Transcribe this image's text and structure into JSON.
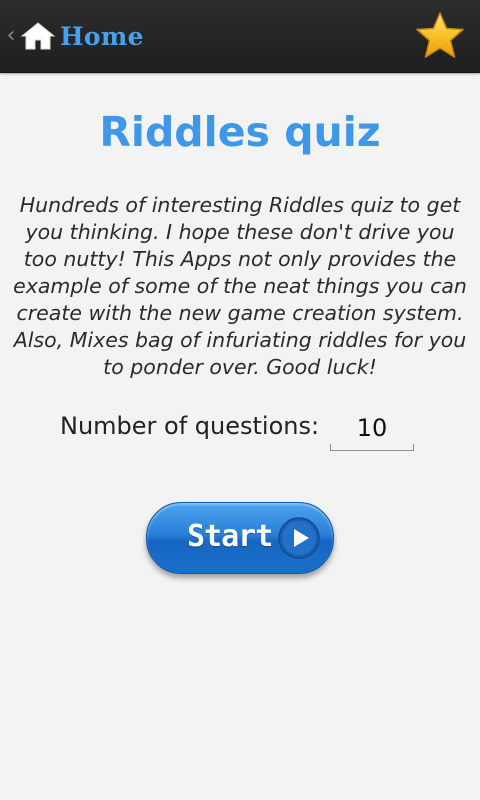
{
  "actionbar": {
    "home_label": "Home",
    "up_caret": "‹",
    "favorite_icon": "star-icon",
    "home_icon": "house-icon"
  },
  "content": {
    "title": "Riddles quiz",
    "description": "Hundreds of interesting Riddles quiz to get you thinking. I hope these don't drive you too nutty! This Apps not only provides the example of some of the neat things you can create with the new game creation system. Also, Mixes bag of infuriating  riddles for you to ponder over. Good luck!",
    "questions_label": "Number of questions:",
    "questions_value": "10",
    "start_label": "Start",
    "start_icon": "play-icon"
  },
  "colors": {
    "accent": "#3e97e8",
    "home_text": "#4aa0ec",
    "actionbar_bg": "#262626",
    "page_bg": "#f3f3f3",
    "star": "#f5b417",
    "button": "#2a7fd8"
  }
}
